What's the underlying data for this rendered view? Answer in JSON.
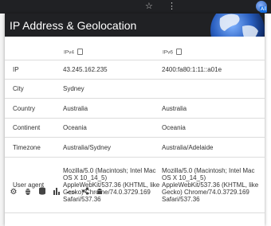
{
  "browser": {
    "star_glyph": "☆",
    "menu_glyph": "⋮",
    "badge": "All"
  },
  "popup": {
    "title": "IP Address & Geolocation",
    "columns": {
      "v4": "IPv4",
      "v6": "IPv6"
    },
    "rows": [
      {
        "label": "IP",
        "v4": "43.245.162.235",
        "v6": "2400:fa80:1:11::a01e"
      },
      {
        "label": "City",
        "v4": "Sydney",
        "v6": ""
      },
      {
        "label": "Country",
        "v4": "Australia",
        "v6": "Australia"
      },
      {
        "label": "Continent",
        "v4": "Oceania",
        "v6": "Oceania"
      },
      {
        "label": "Timezone",
        "v4": "Australia/Sydney",
        "v6": "Australia/Adelaide"
      },
      {
        "label": "User agent",
        "v4": "Mozilla/5.0 (Macintosh; Intel Mac OS X 10_14_5) AppleWebKit/537.36 (KHTML, like Gecko) Chrome/74.0.3729.169 Safari/537.36",
        "v6": "Mozilla/5.0 (Macintosh; Intel Mac OS X 10_14_5) AppleWebKit/537.36 (KHTML, like Gecko) Chrome/74.0.3729.169 Safari/537.36"
      }
    ],
    "footer_icons": [
      "gear-icon",
      "bug-icon",
      "database-icon",
      "bar-chart-icon",
      "code-icon",
      "share-icon",
      "android-icon"
    ]
  }
}
